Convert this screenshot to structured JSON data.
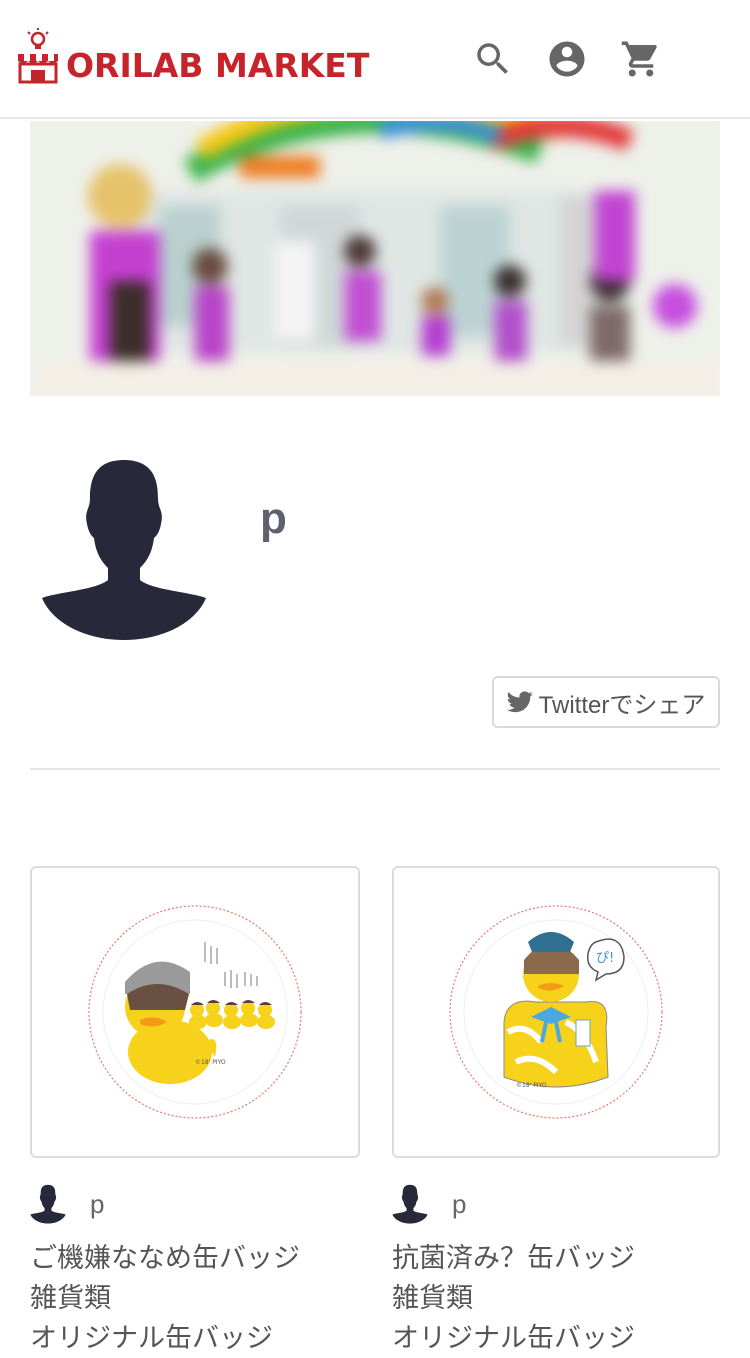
{
  "header": {
    "logo_text": "ORILAB MARKET",
    "icons": [
      "search-icon",
      "account-icon",
      "cart-icon"
    ],
    "brand_color": "#c5242b"
  },
  "profile": {
    "name": "p",
    "share_label": "Twitterでシェア"
  },
  "products": [
    {
      "seller": "p",
      "title": "ご機嫌ななめ缶バッジ",
      "category": "雑貨類",
      "subcategory": "オリジナル缶バッジ"
    },
    {
      "seller": "p",
      "title": "抗菌済み？缶バッジ",
      "category": "雑貨類",
      "subcategory": "オリジナル缶バッジ"
    }
  ]
}
